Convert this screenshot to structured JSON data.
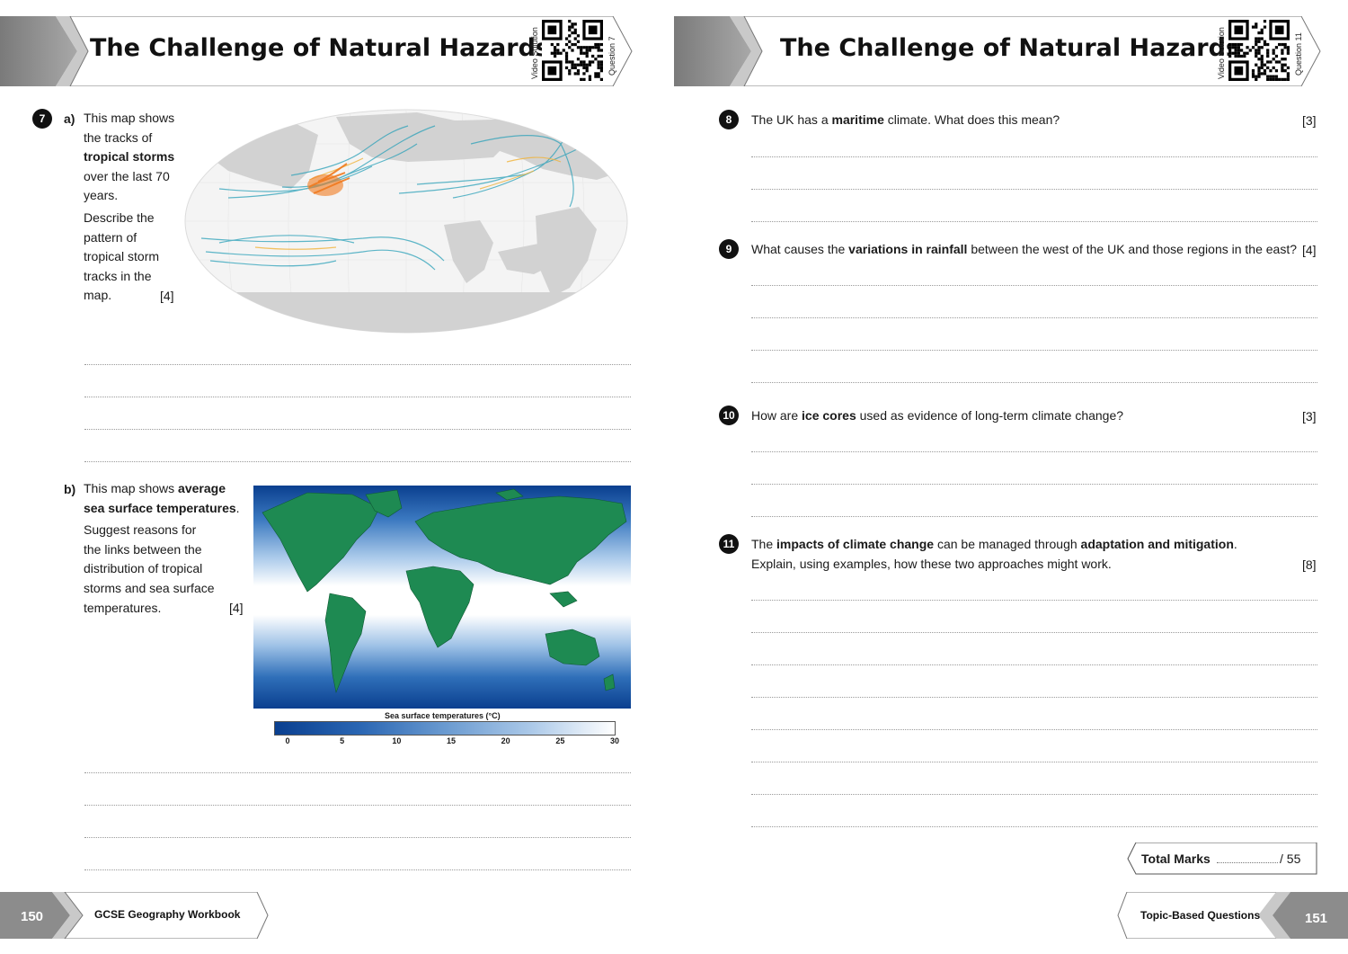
{
  "left": {
    "title": "The Challenge of Natural Hazards",
    "video_label": "Video Solution",
    "question_label": "Question 7",
    "page_number": "150",
    "footer_title": "GCSE Geography Workbook",
    "q7": {
      "number": "7",
      "part_a": "a)",
      "part_a_text_1": "This map shows",
      "part_a_text_2": "the tracks of",
      "part_a_text_3": "tropical storms",
      "part_a_text_4": "over the last 70",
      "part_a_text_5": "years.",
      "part_a_text_6": "Describe the",
      "part_a_text_7": "pattern of",
      "part_a_text_8": "tropical storm",
      "part_a_text_9": "tracks in the",
      "part_a_text_10": "map.",
      "part_a_marks": "[4]",
      "part_b": "b)",
      "part_b_text_1a": "This map shows ",
      "part_b_text_1b": "average",
      "part_b_text_2": "sea surface temperatures",
      "part_b_text_2b": ".",
      "part_b_text_3": "Suggest reasons for",
      "part_b_text_4": "the links between the",
      "part_b_text_5": "distribution of tropical",
      "part_b_text_6": "storms and sea surface",
      "part_b_text_7": "temperatures.",
      "part_b_marks": "[4]",
      "legend_title": "Sea surface temperatures (°C)",
      "legend_ticks": [
        "0",
        "5",
        "10",
        "15",
        "20",
        "25",
        "30"
      ]
    }
  },
  "right": {
    "title": "The Challenge of Natural Hazards",
    "video_label": "Video Solution",
    "question_label": "Question 11",
    "page_number": "151",
    "footer_title": "Topic-Based Questions",
    "q8": {
      "number": "8",
      "pre": "The UK has a ",
      "bold": "maritime",
      "post": " climate. What does this mean?",
      "marks": "[3]"
    },
    "q9": {
      "number": "9",
      "pre": "What causes the ",
      "bold": "variations in rainfall",
      "post": " between the west of the UK and those regions in the east?",
      "marks": "[4]"
    },
    "q10": {
      "number": "10",
      "pre": "How are ",
      "bold": "ice cores",
      "post": " used as evidence of long-term climate change?",
      "marks": "[3]"
    },
    "q11": {
      "number": "11",
      "pre": "The ",
      "bold1": "impacts of climate change",
      "mid": " can be managed through ",
      "bold2": "adaptation and mitigation",
      "post": ".",
      "line2": "Explain, using examples, how these two approaches might work.",
      "marks": "[8]"
    },
    "total_label": "Total Marks",
    "total_value": "/ 55"
  },
  "colors": {
    "header_grey": "#8a8a8a",
    "land_green": "#1e8a52",
    "ocean_blue": "#0a4a9a",
    "storm_teal": "#2aa0b8",
    "storm_orange": "#f07a1e"
  }
}
